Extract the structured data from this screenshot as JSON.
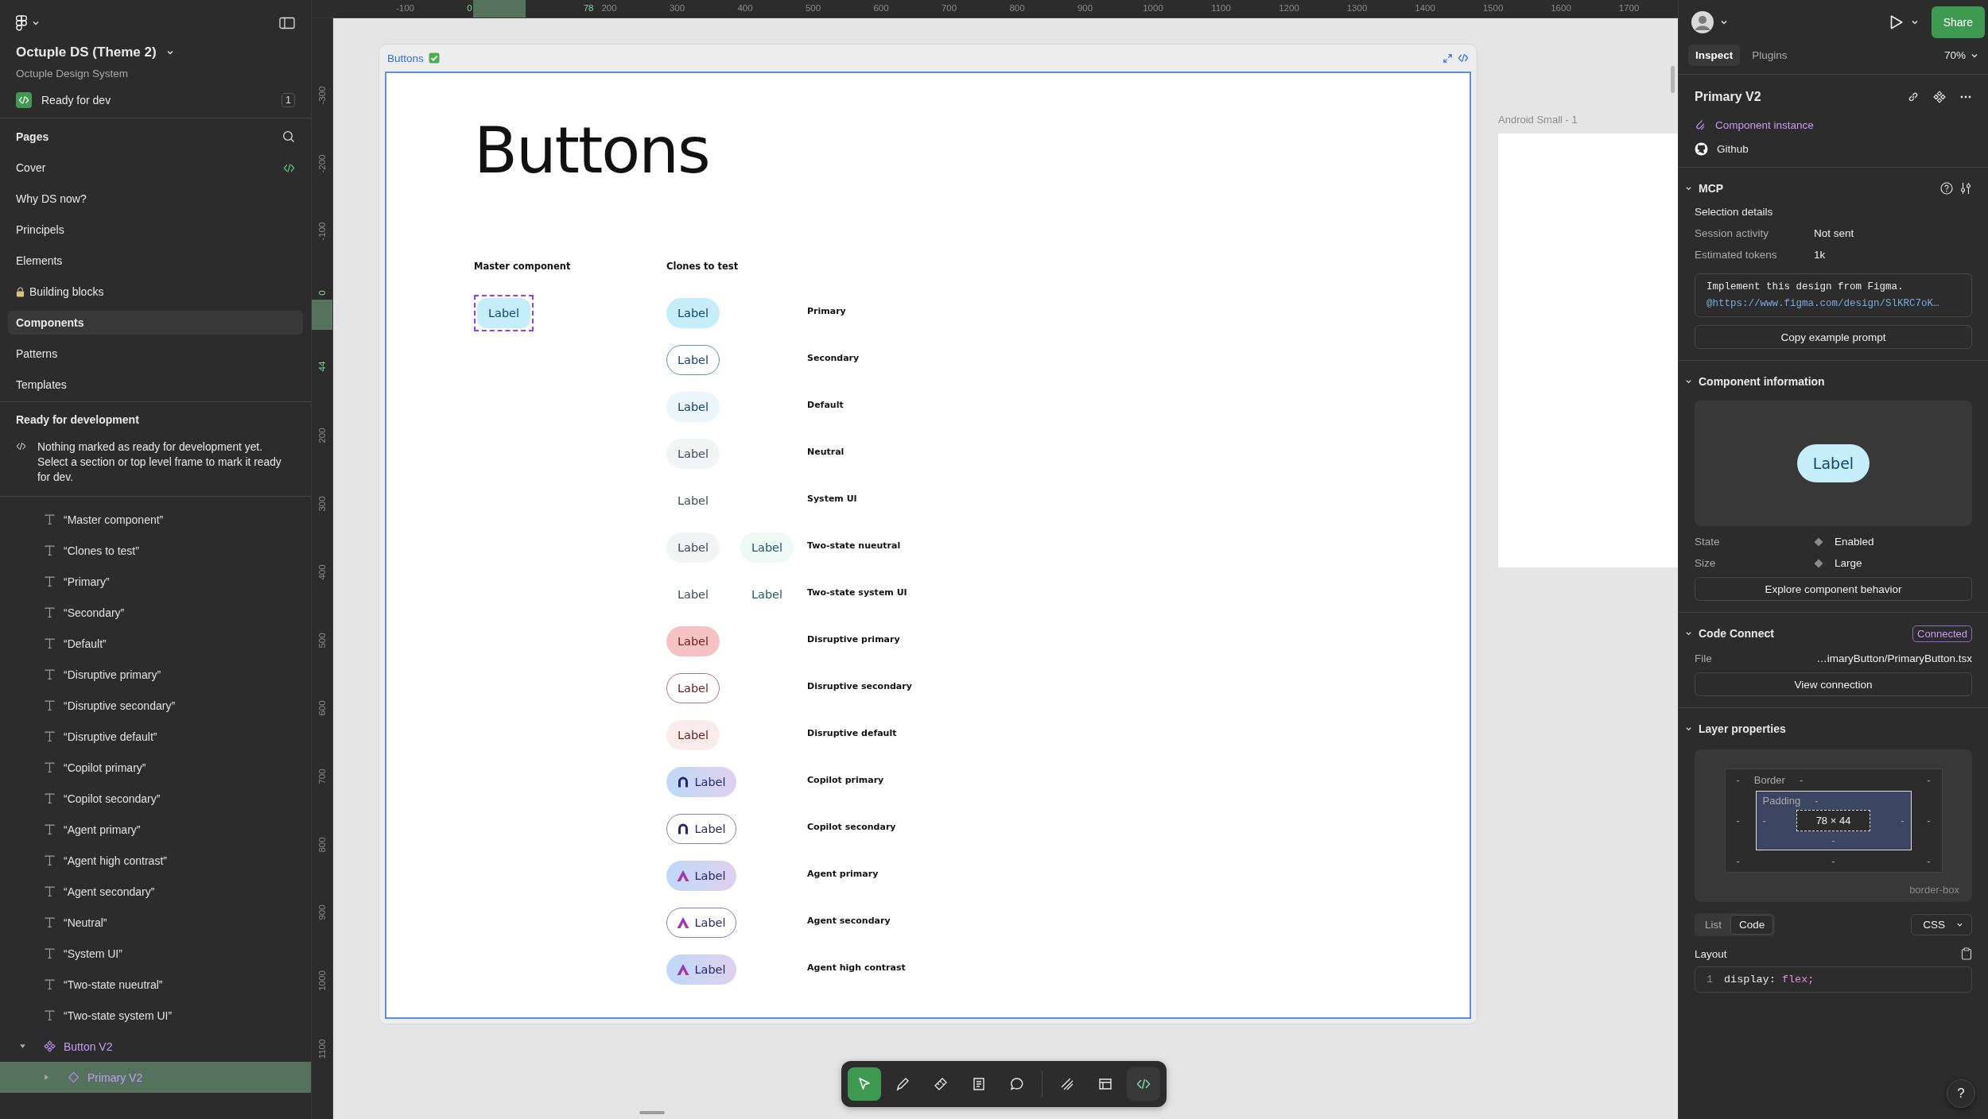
{
  "file": {
    "title": "Octuple DS (Theme 2)",
    "team": "Octuple Design System",
    "ready_for_dev": {
      "label": "Ready for dev",
      "count": "1"
    }
  },
  "pages": {
    "title": "Pages",
    "items": [
      {
        "label": "Cover",
        "selected": false,
        "dev_ready": true,
        "locked": false
      },
      {
        "label": "Why DS now?",
        "selected": false,
        "dev_ready": false,
        "locked": false
      },
      {
        "label": "Principels",
        "selected": false,
        "dev_ready": false,
        "locked": false
      },
      {
        "label": "Elements",
        "selected": false,
        "dev_ready": false,
        "locked": false
      },
      {
        "label": "Building blocks",
        "selected": false,
        "dev_ready": false,
        "locked": true
      },
      {
        "label": "Components",
        "selected": true,
        "dev_ready": false,
        "locked": false
      },
      {
        "label": "Patterns",
        "selected": false,
        "dev_ready": false,
        "locked": false
      },
      {
        "label": "Templates",
        "selected": false,
        "dev_ready": false,
        "locked": false
      }
    ]
  },
  "ready_section": {
    "title": "Ready for development",
    "message": "Nothing marked as ready for development yet. Select a section or top level frame to mark it ready for dev."
  },
  "layers": [
    {
      "label": "“Master component”",
      "kind": "text",
      "selected": false
    },
    {
      "label": "“Clones to test”",
      "kind": "text",
      "selected": false
    },
    {
      "label": "“Primary”",
      "kind": "text",
      "selected": false
    },
    {
      "label": "“Secondary”",
      "kind": "text",
      "selected": false
    },
    {
      "label": "“Default”",
      "kind": "text",
      "selected": false
    },
    {
      "label": "“Disruptive primary”",
      "kind": "text",
      "selected": false
    },
    {
      "label": "“Disruptive secondary”",
      "kind": "text",
      "selected": false
    },
    {
      "label": "“Disruptive default”",
      "kind": "text",
      "selected": false
    },
    {
      "label": "“Copilot primary”",
      "kind": "text",
      "selected": false
    },
    {
      "label": "“Copilot secondary”",
      "kind": "text",
      "selected": false
    },
    {
      "label": "“Agent primary”",
      "kind": "text",
      "selected": false
    },
    {
      "label": "“Agent high contrast”",
      "kind": "text",
      "selected": false
    },
    {
      "label": "“Agent secondary”",
      "kind": "text",
      "selected": false
    },
    {
      "label": "“Neutral”",
      "kind": "text",
      "selected": false
    },
    {
      "label": "“System UI”",
      "kind": "text",
      "selected": false
    },
    {
      "label": "“Two-state nueutral”",
      "kind": "text",
      "selected": false
    },
    {
      "label": "“Two-state system UI”",
      "kind": "text",
      "selected": false
    },
    {
      "label": "Button V2",
      "kind": "component",
      "selected": false,
      "expanded": true,
      "children": [
        {
          "label": "Primary V2",
          "kind": "instance",
          "selected": true,
          "expanded": false
        }
      ]
    }
  ],
  "rulers": {
    "horizontal": [
      {
        "label": "-100",
        "highlight": false
      },
      {
        "label": "0",
        "highlight": true
      },
      {
        "label": "78",
        "highlight": true
      },
      {
        "label": "200",
        "highlight": false
      },
      {
        "label": "300",
        "highlight": false
      },
      {
        "label": "400",
        "highlight": false
      },
      {
        "label": "500",
        "highlight": false
      },
      {
        "label": "600",
        "highlight": false
      },
      {
        "label": "700",
        "highlight": false
      },
      {
        "label": "800",
        "highlight": false
      },
      {
        "label": "900",
        "highlight": false
      },
      {
        "label": "1000",
        "highlight": false
      },
      {
        "label": "1100",
        "highlight": false
      },
      {
        "label": "1200",
        "highlight": false
      },
      {
        "label": "1300",
        "highlight": false
      },
      {
        "label": "1400",
        "highlight": false
      },
      {
        "label": "1500",
        "highlight": false
      },
      {
        "label": "1600",
        "highlight": false
      },
      {
        "label": "1700",
        "highlight": false
      }
    ],
    "vertical": [
      {
        "label": "-300",
        "highlight": false
      },
      {
        "label": "-200",
        "highlight": false
      },
      {
        "label": "-100",
        "highlight": false
      },
      {
        "label": "0",
        "highlight": true
      },
      {
        "label": "44",
        "highlight": true
      },
      {
        "label": "200",
        "highlight": false
      },
      {
        "label": "300",
        "highlight": false
      },
      {
        "label": "400",
        "highlight": false
      },
      {
        "label": "500",
        "highlight": false
      },
      {
        "label": "600",
        "highlight": false
      },
      {
        "label": "700",
        "highlight": false
      },
      {
        "label": "800",
        "highlight": false
      },
      {
        "label": "900",
        "highlight": false
      },
      {
        "label": "1000",
        "highlight": false
      },
      {
        "label": "1100",
        "highlight": false
      }
    ]
  },
  "canvas": {
    "section": {
      "title": "Buttons",
      "done": true
    },
    "frame": {
      "heading": "Buttons",
      "master_heading": "Master component",
      "clones_heading": "Clones to test",
      "master": {
        "text": "Label",
        "kind": "primary",
        "selected": true
      },
      "rows": [
        {
          "label": "Primary",
          "buttons": [
            {
              "text": "Label",
              "kind": "primary"
            }
          ]
        },
        {
          "label": "Secondary",
          "buttons": [
            {
              "text": "Label",
              "kind": "secondary"
            }
          ]
        },
        {
          "label": "Default",
          "buttons": [
            {
              "text": "Label",
              "kind": "default"
            }
          ]
        },
        {
          "label": "Neutral",
          "buttons": [
            {
              "text": "Label",
              "kind": "neutral"
            }
          ]
        },
        {
          "label": "System UI",
          "buttons": [
            {
              "text": "Label",
              "kind": "system"
            }
          ]
        },
        {
          "label": "Two-state nueutral",
          "buttons": [
            {
              "text": "Label",
              "kind": "neutral"
            },
            {
              "text": "Label",
              "kind": "neutral-on"
            }
          ]
        },
        {
          "label": "Two-state system UI",
          "buttons": [
            {
              "text": "Label",
              "kind": "system"
            },
            {
              "text": "Label",
              "kind": "system-on"
            }
          ]
        },
        {
          "label": "Disruptive primary",
          "buttons": [
            {
              "text": "Label",
              "kind": "disruptive-primary"
            }
          ]
        },
        {
          "label": "Disruptive secondary",
          "buttons": [
            {
              "text": "Label",
              "kind": "disruptive-secondary"
            }
          ]
        },
        {
          "label": "Disruptive default",
          "buttons": [
            {
              "text": "Label",
              "kind": "disruptive-default"
            }
          ]
        },
        {
          "label": "Copilot primary",
          "buttons": [
            {
              "text": "Label",
              "kind": "copilot-primary"
            }
          ]
        },
        {
          "label": "Copilot secondary",
          "buttons": [
            {
              "text": "Label",
              "kind": "copilot-secondary"
            }
          ]
        },
        {
          "label": "Agent primary",
          "buttons": [
            {
              "text": "Label",
              "kind": "agent-primary"
            }
          ]
        },
        {
          "label": "Agent secondary",
          "buttons": [
            {
              "text": "Label",
              "kind": "agent-secondary"
            }
          ]
        },
        {
          "label": "Agent high contrast",
          "buttons": [
            {
              "text": "Label",
              "kind": "agent-high-contrast"
            }
          ]
        }
      ]
    },
    "side_frame": {
      "title": "Android Small - 1"
    },
    "toolbar": {
      "tools": [
        {
          "kind": "move",
          "selected": true
        },
        {
          "kind": "pen",
          "selected": false
        },
        {
          "kind": "measure",
          "selected": false
        },
        {
          "kind": "annotate",
          "selected": false
        },
        {
          "kind": "comment",
          "selected": false
        }
      ],
      "dev_tools": [
        {
          "kind": "draw",
          "selected": false
        },
        {
          "kind": "properties",
          "selected": false
        },
        {
          "kind": "code",
          "selected": true
        }
      ]
    }
  },
  "inspector": {
    "share": "Share",
    "zoom": "70%",
    "tabs": [
      {
        "label": "Inspect",
        "selected": true
      },
      {
        "label": "Plugins",
        "selected": false
      }
    ],
    "selection": {
      "name": "Primary V2",
      "instance_label": "Component instance",
      "repo_link": "Github"
    },
    "mcp": {
      "title": "MCP",
      "expanded": true,
      "subtitle": "Selection details",
      "rows": [
        {
          "label": "Session activity",
          "value": "Not sent"
        },
        {
          "label": "Estimated tokens",
          "value": "1k"
        }
      ],
      "prompt": "Implement this design from Figma.",
      "prompt_link": "@https://www.figma.com/design/SlKRC7oK…",
      "button": "Copy example prompt"
    },
    "component_info": {
      "title": "Component information",
      "expanded": true,
      "preview_label": "Label",
      "properties": [
        {
          "label": "State",
          "value": "Enabled"
        },
        {
          "label": "Size",
          "value": "Large"
        }
      ],
      "button": "Explore component behavior"
    },
    "code_connect": {
      "title": "Code Connect",
      "expanded": true,
      "status": "Connected",
      "file_label": "File",
      "file": "…imaryButton/PrimaryButton.tsx",
      "button": "View connection"
    },
    "layer_properties": {
      "title": "Layer properties",
      "expanded": true,
      "border_label": "Border",
      "padding_label": "Padding",
      "outer_top": [
        "-",
        "-",
        "-"
      ],
      "outer_sides": [
        "-",
        "-"
      ],
      "outer_bottom": [
        "-",
        "-",
        "-"
      ],
      "padding_top": "-",
      "padding_sides": [
        "-",
        "-"
      ],
      "padding_bottom": "-",
      "size": "78 × 44",
      "sizing": "border-box",
      "views": [
        {
          "label": "List",
          "selected": false
        },
        {
          "label": "Code",
          "selected": true
        }
      ],
      "language": "CSS",
      "section": "Layout",
      "code": [
        {
          "number": "1",
          "property": "display:",
          "value": "flex;"
        }
      ]
    },
    "help": "?"
  }
}
